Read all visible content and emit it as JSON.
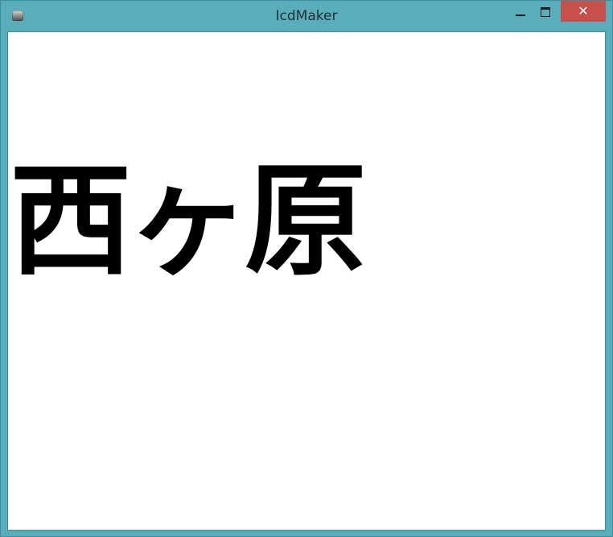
{
  "window": {
    "title": "IcdMaker",
    "icon": "app-icon",
    "controls": {
      "minimize_icon": "minimize-icon",
      "maximize_icon": "maximize-icon",
      "close_label": "✕"
    }
  },
  "content": {
    "text": "西ヶ原"
  },
  "colors": {
    "frame": "#5aaebc",
    "close_button": "#c7504c",
    "client_background": "#ffffff",
    "text": "#000000"
  }
}
